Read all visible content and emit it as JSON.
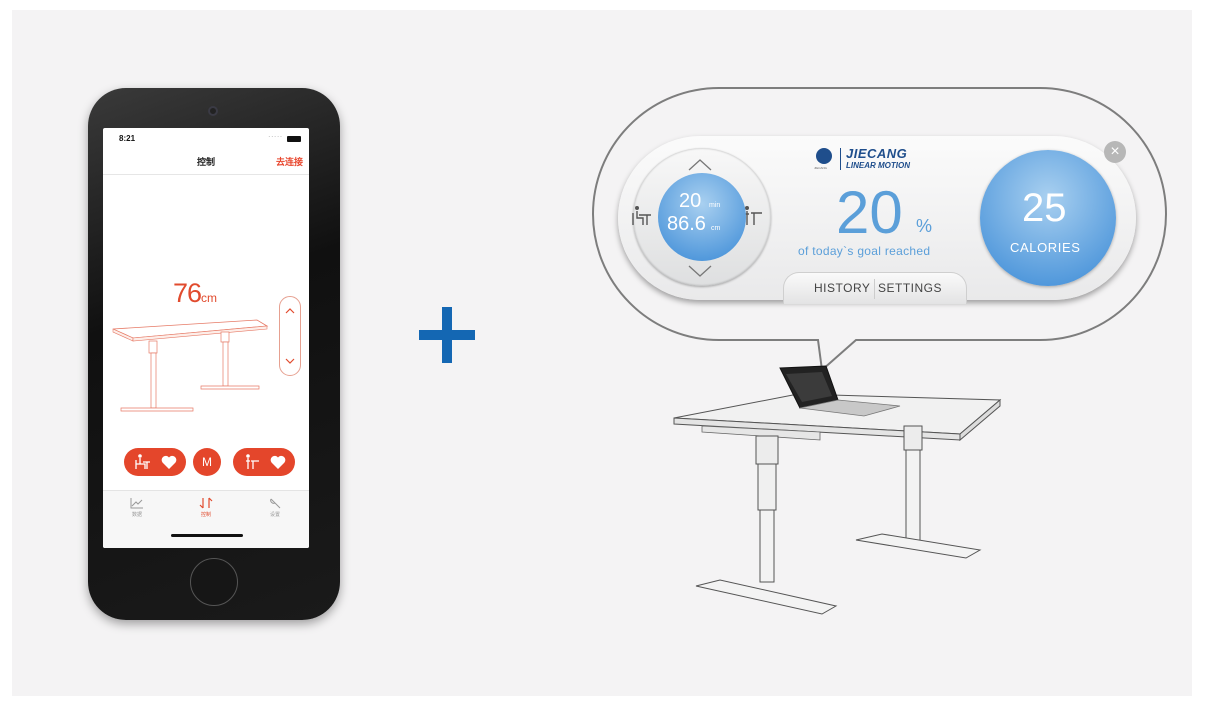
{
  "phone_app": {
    "status_time": "8:21",
    "status_signal": ".....",
    "nav_title": "控制",
    "nav_action": "去连接",
    "desk_height_value": "76",
    "desk_height_unit": "cm",
    "preset_memory_label": "M",
    "tabs": [
      {
        "label": "数据",
        "icon": "chart-icon"
      },
      {
        "label": "控制",
        "icon": "control-icon",
        "active": true
      },
      {
        "label": "设置",
        "icon": "wrench-icon"
      }
    ]
  },
  "widget": {
    "brand_name": "JIECANG",
    "brand_tagline": "LINEAR MOTION",
    "brand_small": "JIECANG",
    "dial": {
      "time_value": "20",
      "time_unit": "min",
      "height_value": "86.6",
      "height_unit": "cm"
    },
    "goal": {
      "value": "20",
      "unit": "%",
      "caption": "of today`s goal reached"
    },
    "tabs": {
      "history": "HISTORY",
      "settings": "SETTINGS"
    },
    "calories": {
      "value": "25",
      "label": "CALORIES"
    },
    "close_symbol": "×"
  },
  "colors": {
    "accent_red": "#e4462b",
    "accent_blue": "#5b9fd9",
    "brand_blue": "#1f4e8c",
    "plus_blue": "#1467b3"
  }
}
